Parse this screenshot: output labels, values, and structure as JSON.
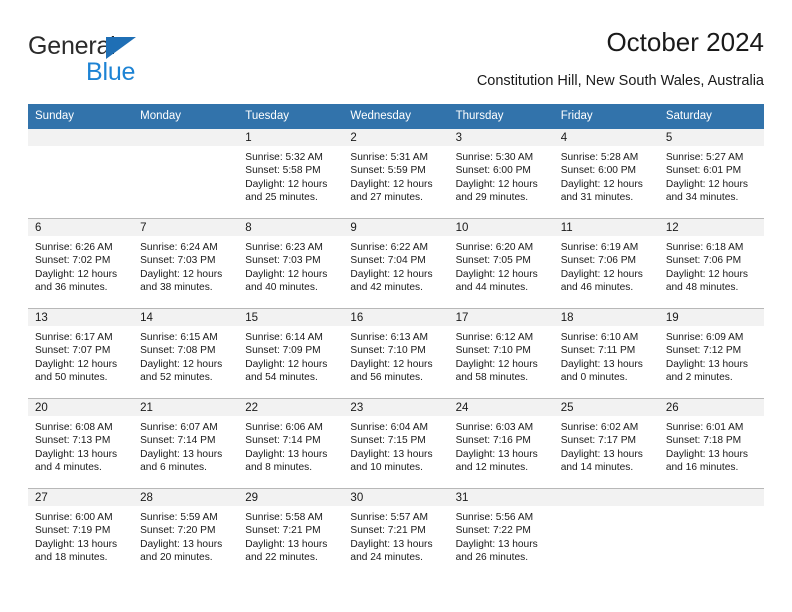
{
  "brand": {
    "name_part1": "General",
    "name_part2": "Blue",
    "accent_color": "#1d83d4",
    "triangle_color": "#1f6fb5"
  },
  "header": {
    "title": "October 2024",
    "subtitle": "Constitution Hill, New South Wales, Australia",
    "weekday_header_color": "#3273ab"
  },
  "calendar": {
    "weekdays": [
      "Sunday",
      "Monday",
      "Tuesday",
      "Wednesday",
      "Thursday",
      "Friday",
      "Saturday"
    ],
    "weeks": [
      [
        {
          "day": "",
          "lines": []
        },
        {
          "day": "",
          "lines": []
        },
        {
          "day": "1",
          "lines": [
            "Sunrise: 5:32 AM",
            "Sunset: 5:58 PM",
            "Daylight: 12 hours",
            "and 25 minutes."
          ]
        },
        {
          "day": "2",
          "lines": [
            "Sunrise: 5:31 AM",
            "Sunset: 5:59 PM",
            "Daylight: 12 hours",
            "and 27 minutes."
          ]
        },
        {
          "day": "3",
          "lines": [
            "Sunrise: 5:30 AM",
            "Sunset: 6:00 PM",
            "Daylight: 12 hours",
            "and 29 minutes."
          ]
        },
        {
          "day": "4",
          "lines": [
            "Sunrise: 5:28 AM",
            "Sunset: 6:00 PM",
            "Daylight: 12 hours",
            "and 31 minutes."
          ]
        },
        {
          "day": "5",
          "lines": [
            "Sunrise: 5:27 AM",
            "Sunset: 6:01 PM",
            "Daylight: 12 hours",
            "and 34 minutes."
          ]
        }
      ],
      [
        {
          "day": "6",
          "lines": [
            "Sunrise: 6:26 AM",
            "Sunset: 7:02 PM",
            "Daylight: 12 hours",
            "and 36 minutes."
          ]
        },
        {
          "day": "7",
          "lines": [
            "Sunrise: 6:24 AM",
            "Sunset: 7:03 PM",
            "Daylight: 12 hours",
            "and 38 minutes."
          ]
        },
        {
          "day": "8",
          "lines": [
            "Sunrise: 6:23 AM",
            "Sunset: 7:03 PM",
            "Daylight: 12 hours",
            "and 40 minutes."
          ]
        },
        {
          "day": "9",
          "lines": [
            "Sunrise: 6:22 AM",
            "Sunset: 7:04 PM",
            "Daylight: 12 hours",
            "and 42 minutes."
          ]
        },
        {
          "day": "10",
          "lines": [
            "Sunrise: 6:20 AM",
            "Sunset: 7:05 PM",
            "Daylight: 12 hours",
            "and 44 minutes."
          ]
        },
        {
          "day": "11",
          "lines": [
            "Sunrise: 6:19 AM",
            "Sunset: 7:06 PM",
            "Daylight: 12 hours",
            "and 46 minutes."
          ]
        },
        {
          "day": "12",
          "lines": [
            "Sunrise: 6:18 AM",
            "Sunset: 7:06 PM",
            "Daylight: 12 hours",
            "and 48 minutes."
          ]
        }
      ],
      [
        {
          "day": "13",
          "lines": [
            "Sunrise: 6:17 AM",
            "Sunset: 7:07 PM",
            "Daylight: 12 hours",
            "and 50 minutes."
          ]
        },
        {
          "day": "14",
          "lines": [
            "Sunrise: 6:15 AM",
            "Sunset: 7:08 PM",
            "Daylight: 12 hours",
            "and 52 minutes."
          ]
        },
        {
          "day": "15",
          "lines": [
            "Sunrise: 6:14 AM",
            "Sunset: 7:09 PM",
            "Daylight: 12 hours",
            "and 54 minutes."
          ]
        },
        {
          "day": "16",
          "lines": [
            "Sunrise: 6:13 AM",
            "Sunset: 7:10 PM",
            "Daylight: 12 hours",
            "and 56 minutes."
          ]
        },
        {
          "day": "17",
          "lines": [
            "Sunrise: 6:12 AM",
            "Sunset: 7:10 PM",
            "Daylight: 12 hours",
            "and 58 minutes."
          ]
        },
        {
          "day": "18",
          "lines": [
            "Sunrise: 6:10 AM",
            "Sunset: 7:11 PM",
            "Daylight: 13 hours",
            "and 0 minutes."
          ]
        },
        {
          "day": "19",
          "lines": [
            "Sunrise: 6:09 AM",
            "Sunset: 7:12 PM",
            "Daylight: 13 hours",
            "and 2 minutes."
          ]
        }
      ],
      [
        {
          "day": "20",
          "lines": [
            "Sunrise: 6:08 AM",
            "Sunset: 7:13 PM",
            "Daylight: 13 hours",
            "and 4 minutes."
          ]
        },
        {
          "day": "21",
          "lines": [
            "Sunrise: 6:07 AM",
            "Sunset: 7:14 PM",
            "Daylight: 13 hours",
            "and 6 minutes."
          ]
        },
        {
          "day": "22",
          "lines": [
            "Sunrise: 6:06 AM",
            "Sunset: 7:14 PM",
            "Daylight: 13 hours",
            "and 8 minutes."
          ]
        },
        {
          "day": "23",
          "lines": [
            "Sunrise: 6:04 AM",
            "Sunset: 7:15 PM",
            "Daylight: 13 hours",
            "and 10 minutes."
          ]
        },
        {
          "day": "24",
          "lines": [
            "Sunrise: 6:03 AM",
            "Sunset: 7:16 PM",
            "Daylight: 13 hours",
            "and 12 minutes."
          ]
        },
        {
          "day": "25",
          "lines": [
            "Sunrise: 6:02 AM",
            "Sunset: 7:17 PM",
            "Daylight: 13 hours",
            "and 14 minutes."
          ]
        },
        {
          "day": "26",
          "lines": [
            "Sunrise: 6:01 AM",
            "Sunset: 7:18 PM",
            "Daylight: 13 hours",
            "and 16 minutes."
          ]
        }
      ],
      [
        {
          "day": "27",
          "lines": [
            "Sunrise: 6:00 AM",
            "Sunset: 7:19 PM",
            "Daylight: 13 hours",
            "and 18 minutes."
          ]
        },
        {
          "day": "28",
          "lines": [
            "Sunrise: 5:59 AM",
            "Sunset: 7:20 PM",
            "Daylight: 13 hours",
            "and 20 minutes."
          ]
        },
        {
          "day": "29",
          "lines": [
            "Sunrise: 5:58 AM",
            "Sunset: 7:21 PM",
            "Daylight: 13 hours",
            "and 22 minutes."
          ]
        },
        {
          "day": "30",
          "lines": [
            "Sunrise: 5:57 AM",
            "Sunset: 7:21 PM",
            "Daylight: 13 hours",
            "and 24 minutes."
          ]
        },
        {
          "day": "31",
          "lines": [
            "Sunrise: 5:56 AM",
            "Sunset: 7:22 PM",
            "Daylight: 13 hours",
            "and 26 minutes."
          ]
        },
        {
          "day": "",
          "lines": []
        },
        {
          "day": "",
          "lines": []
        }
      ]
    ]
  }
}
